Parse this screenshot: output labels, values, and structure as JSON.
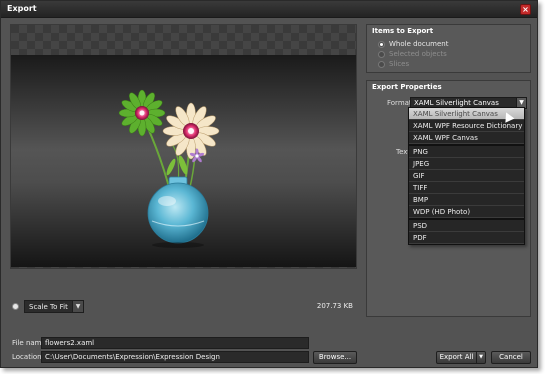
{
  "window": {
    "title": "Export",
    "close_label": "×"
  },
  "preview": {
    "scale_label": "Scale To Fit",
    "file_size": "207.73 KB"
  },
  "items_panel": {
    "title": "Items to Export",
    "options": [
      {
        "label": "Whole document",
        "selected": true,
        "enabled": true
      },
      {
        "label": "Selected objects",
        "selected": false,
        "enabled": false
      },
      {
        "label": "Slices",
        "selected": false,
        "enabled": false
      }
    ]
  },
  "props_panel": {
    "title": "Export Properties",
    "format_label": "Format",
    "format_value": "XAML Silverlight Canvas",
    "text_label": "Text"
  },
  "format_dropdown": {
    "groups": [
      [
        "XAML Silverlight Canvas",
        "XAML WPF Resource Dictionary",
        "XAML WPF Canvas"
      ],
      [
        "PNG",
        "JPEG",
        "GIF",
        "TIFF",
        "BMP",
        "WDP (HD Photo)"
      ],
      [
        "PSD",
        "PDF"
      ]
    ],
    "highlighted": "XAML Silverlight Canvas"
  },
  "footer": {
    "file_name_label": "File name",
    "file_name_value": "flowers2.xaml",
    "location_label": "Location",
    "location_value": "C:\\User\\Documents\\Expression\\Expression Design",
    "browse_label": "Browse...",
    "export_all_label": "Export All",
    "cancel_label": "Cancel"
  },
  "colors": {
    "accent_close": "#c42a2a",
    "selected_item": "#cfcfcf",
    "panel": "#595959",
    "window": "#535353"
  }
}
